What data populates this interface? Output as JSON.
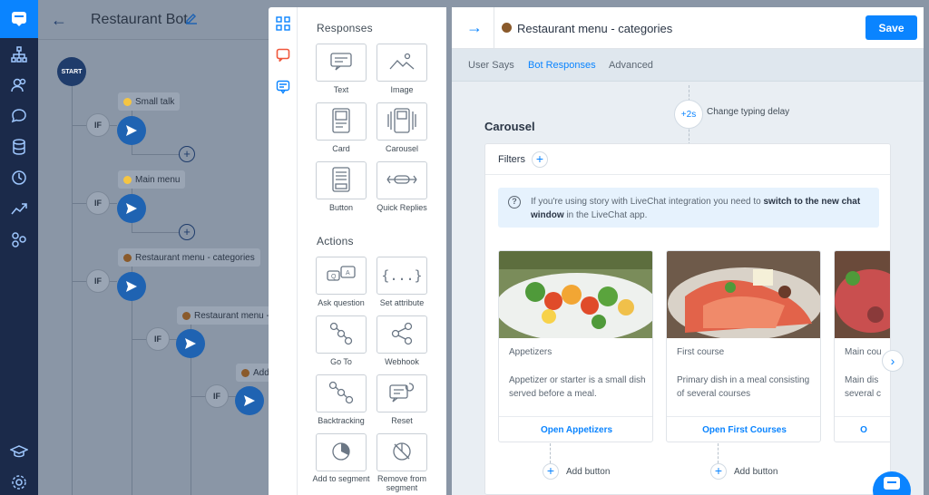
{
  "app": {
    "bot_title": "Restaurant Bot",
    "rail_icons": [
      "chatbot-logo-icon",
      "stories-icon",
      "users-icon",
      "chats-icon",
      "database-icon",
      "history-icon",
      "reports-icon",
      "integrations-icon",
      "academy-icon",
      "settings-icon"
    ]
  },
  "canvas": {
    "start_label": "START",
    "if_label": "IF",
    "nodes": [
      {
        "label": "Small talk",
        "emoji_color": "#f5c542"
      },
      {
        "label": "Main menu",
        "emoji_color": "#f5c542"
      },
      {
        "label": "Restaurant menu - categories",
        "emoji_color": "#8a5a2b"
      },
      {
        "label": "Restaurant menu -",
        "emoji_color": "#8a5a2b"
      },
      {
        "label": "Add",
        "emoji_color": "#8a5a2b"
      }
    ]
  },
  "picker": {
    "responses_title": "Responses",
    "actions_title": "Actions",
    "responses": [
      {
        "label": "Text",
        "icon": "text-icon"
      },
      {
        "label": "Image",
        "icon": "image-icon"
      },
      {
        "label": "Card",
        "icon": "card-icon"
      },
      {
        "label": "Carousel",
        "icon": "carousel-icon"
      },
      {
        "label": "Button",
        "icon": "button-icon"
      },
      {
        "label": "Quick Replies",
        "icon": "quick-replies-icon"
      }
    ],
    "actions": [
      {
        "label": "Ask question",
        "icon": "ask-question-icon"
      },
      {
        "label": "Set attribute",
        "icon": "set-attribute-icon"
      },
      {
        "label": "Go To",
        "icon": "goto-icon"
      },
      {
        "label": "Webhook",
        "icon": "webhook-icon"
      },
      {
        "label": "Backtracking",
        "icon": "backtracking-icon"
      },
      {
        "label": "Reset",
        "icon": "reset-icon"
      },
      {
        "label": "Add to segment",
        "icon": "add-segment-icon"
      },
      {
        "label": "Remove from segment",
        "icon": "remove-segment-icon"
      }
    ]
  },
  "editor": {
    "title": "Restaurant menu - categories",
    "save_label": "Save",
    "tabs": [
      "User Says",
      "Bot Responses",
      "Advanced"
    ],
    "active_tab": "Bot Responses",
    "delay_value": "+2s",
    "delay_label": "Change typing delay",
    "carousel_title": "Carousel",
    "filters_label": "Filters",
    "info_text_1": "If you're using story with LiveChat integration you need to ",
    "info_text_bold": "switch to the new chat window",
    "info_text_2": " in the LiveChat app.",
    "cards": [
      {
        "name": "Appetizers",
        "description": "Appetizer or starter is a small dish served before a meal.",
        "button": "Open Appetizers"
      },
      {
        "name": "First course",
        "description": "Primary dish in a meal consisting of several courses",
        "button": "Open First Courses"
      },
      {
        "name": "Main cou",
        "description": "Main dis several c",
        "button": "O"
      }
    ],
    "add_button_label": "Add button"
  },
  "colors": {
    "accent": "#0a84ff",
    "rail": "#1b2a4a"
  }
}
